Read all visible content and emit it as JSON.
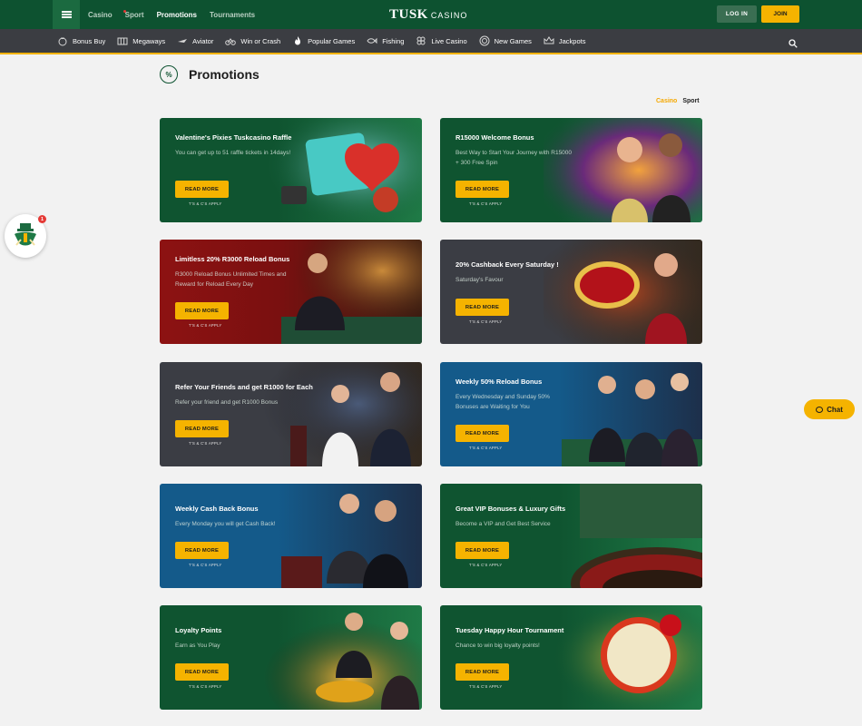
{
  "header": {
    "nav": [
      "Casino",
      "Sport",
      "Promotions",
      "Tournaments"
    ],
    "logo_main": "TUSK",
    "logo_sub": "CASINO",
    "login_label": "LOG IN",
    "join_label": "JOIN"
  },
  "categories": [
    {
      "label": "Bonus Buy",
      "icon": "money-bag-icon"
    },
    {
      "label": "Megaways",
      "icon": "slot-icon"
    },
    {
      "label": "Aviator",
      "icon": "plane-icon"
    },
    {
      "label": "Win or Crash",
      "icon": "bike-icon"
    },
    {
      "label": "Popular Games",
      "icon": "fire-icon"
    },
    {
      "label": "Fishing",
      "icon": "fish-icon"
    },
    {
      "label": "Live Casino",
      "icon": "cards-icon"
    },
    {
      "label": "New Games",
      "icon": "chip-icon"
    },
    {
      "label": "Jackpots",
      "icon": "crown-icon"
    }
  ],
  "page": {
    "title": "Promotions",
    "filter_casino": "Casino",
    "filter_sport": "Sport"
  },
  "promos": [
    {
      "title": "Valentine's Pixies  Tuskcasino Raffle",
      "desc": "You can get up to 51 raffle tickets in 14days!",
      "button": "READ MORE",
      "tc": "T'S & C'S APPLY"
    },
    {
      "title": "R15000 Welcome Bonus",
      "desc": "Best Way to Start Your Journey with R15000 + 300 Free Spin",
      "button": "READ MORE",
      "tc": "T'S & C'S APPLY"
    },
    {
      "title": "Limitless 20% R3000 Reload Bonus",
      "desc": "R3000 Reload Bonus Unlimited Times and Reward for Reload Every Day",
      "button": "READ MORE",
      "tc": "T'S & C'S APPLY"
    },
    {
      "title": "20% Cashback Every Saturday !",
      "desc": "Saturday's Favour",
      "button": "READ MORE",
      "tc": "T'S & C'S APPLY"
    },
    {
      "title": "Refer Your Friends and get R1000 for Each",
      "desc": "Refer your friend and get R1000 Bonus",
      "button": "READ MORE",
      "tc": "T'S & C'S APPLY"
    },
    {
      "title": "Weekly 50% Reload Bonus",
      "desc": "Every Wednesday and Sunday 50% Bonuses are Waiting for You",
      "button": "READ MORE",
      "tc": "T'S & C'S APPLY"
    },
    {
      "title": "Weekly Cash Back Bonus",
      "desc": "Every Monday you will get Cash Back!",
      "button": "READ MORE",
      "tc": "T'S & C'S APPLY"
    },
    {
      "title": "Great VIP Bonuses & Luxury Gifts",
      "desc": "Become a VIP and Get Best Service",
      "button": "READ MORE",
      "tc": "T'S & C'S APPLY"
    },
    {
      "title": "Loyalty Points",
      "desc": "Earn as You Play",
      "button": "READ MORE",
      "tc": "T'S & C'S APPLY"
    },
    {
      "title": "Tuesday Happy Hour Tournament",
      "desc": "Chance to win big loyalty points!",
      "button": "READ MORE",
      "tc": "T'S & C'S APPLY"
    }
  ],
  "floating": {
    "badge_count": "1",
    "chat_label": "Chat"
  }
}
